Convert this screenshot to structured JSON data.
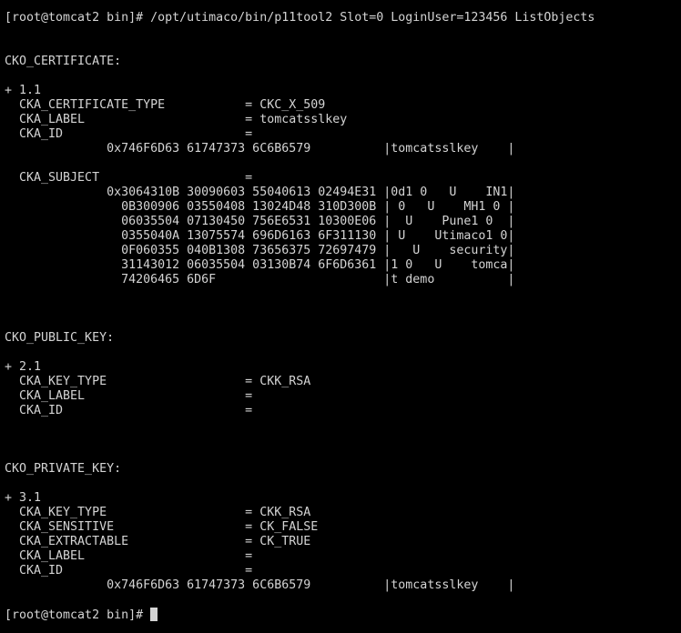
{
  "terminal": {
    "colors": {
      "background": "#000000",
      "foreground": "#d4d4d4"
    },
    "lines": [
      "[root@tomcat2 bin]# /opt/utimaco/bin/p11tool2 Slot=0 LoginUser=123456 ListObjects",
      "",
      "",
      "CKO_CERTIFICATE:",
      "",
      "+ 1.1",
      "  CKA_CERTIFICATE_TYPE           = CKC_X_509",
      "  CKA_LABEL                      = tomcatsslkey",
      "  CKA_ID                         =",
      "              0x746F6D63 61747373 6C6B6579          |tomcatsslkey    |",
      "",
      "  CKA_SUBJECT                    =",
      "              0x3064310B 30090603 55040613 02494E31 |0d1 0   U    IN1|",
      "                0B300906 03550408 13024D48 310D300B | 0   U    MH1 0 |",
      "                06035504 07130450 756E6531 10300E06 |  U    Pune1 0  |",
      "                0355040A 13075574 696D6163 6F311130 | U    Utimaco1 0|",
      "                0F060355 040B1308 73656375 72697479 |   U    security|",
      "                31143012 06035504 03130B74 6F6D6361 |1 0   U    tomca|",
      "                74206465 6D6F                       |t demo          |",
      "",
      "",
      "",
      "CKO_PUBLIC_KEY:",
      "",
      "+ 2.1",
      "  CKA_KEY_TYPE                   = CKK_RSA",
      "  CKA_LABEL                      =",
      "  CKA_ID                         =",
      "",
      "",
      "",
      "CKO_PRIVATE_KEY:",
      "",
      "+ 3.1",
      "  CKA_KEY_TYPE                   = CKK_RSA",
      "  CKA_SENSITIVE                  = CK_FALSE",
      "  CKA_EXTRACTABLE                = CK_TRUE",
      "  CKA_LABEL                      =",
      "  CKA_ID                         =",
      "              0x746F6D63 61747373 6C6B6579          |tomcatsslkey    |",
      "",
      "[root@tomcat2 bin]# "
    ]
  }
}
